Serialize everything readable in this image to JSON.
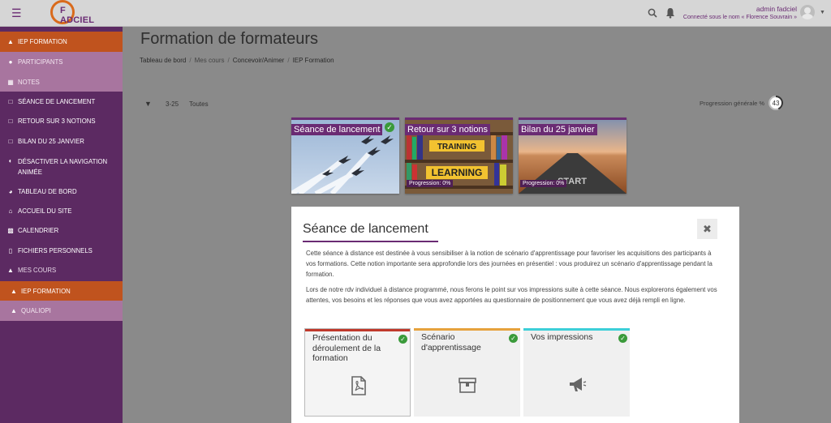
{
  "topbar": {
    "menu_icon": "hamburger-icon",
    "logo_text": "F ADCIEL",
    "user_name": "admin fadciel",
    "user_role": "Connecté sous le nom « Florence Souvrain »",
    "search_icon": "search-icon",
    "bell_icon": "bell-icon"
  },
  "sidebar": {
    "items": [
      {
        "label": "IEP FORMATION",
        "icon": "graduation-cap-icon",
        "state": "active"
      },
      {
        "label": "PARTICIPANTS",
        "icon": "users-icon",
        "state": "sub"
      },
      {
        "label": "NOTES",
        "icon": "table-icon",
        "state": "sub"
      },
      {
        "label": "SÉANCE DE LANCEMENT",
        "icon": "folder-icon",
        "state": "normal"
      },
      {
        "label": "RETOUR SUR 3 NOTIONS",
        "icon": "folder-icon",
        "state": "normal"
      },
      {
        "label": "BILAN DU 25 JANVIER",
        "icon": "folder-icon",
        "state": "normal"
      },
      {
        "label": "DÉSACTIVER LA NAVIGATION ANIMÉE",
        "icon": "toggle-icon",
        "state": "normal"
      },
      {
        "label": "TABLEAU DE BORD",
        "icon": "dashboard-icon",
        "state": "normal"
      },
      {
        "label": "ACCUEIL DU SITE",
        "icon": "home-icon",
        "state": "normal"
      },
      {
        "label": "CALENDRIER",
        "icon": "calendar-icon",
        "state": "normal"
      },
      {
        "label": "FICHIERS PERSONNELS",
        "icon": "file-icon",
        "state": "normal"
      },
      {
        "label": "MES COURS",
        "icon": "graduation-cap-icon",
        "state": "normal"
      },
      {
        "label": "IEP FORMATION",
        "icon": "graduation-cap-icon",
        "state": "active-sub"
      },
      {
        "label": "QUALIOPI",
        "icon": "graduation-cap-icon",
        "state": "sub2"
      }
    ]
  },
  "main": {
    "title": "Formation de formateurs",
    "breadcrumb": [
      "Tableau de bord",
      "Mes cours",
      "Concevoir/Animer",
      "IEP Formation"
    ],
    "filter": {
      "range": "3-25",
      "all": "Toutes"
    },
    "progress": {
      "label": "Progression générale %",
      "value": 43
    }
  },
  "cards": [
    {
      "title": "Séance de lancement",
      "completed": true,
      "progress": ""
    },
    {
      "title": "Retour sur 3 notions",
      "completed": false,
      "progress": "Progression: 0%"
    },
    {
      "title": "Bilan du 25 janvier",
      "completed": false,
      "progress": "Progression: 0%"
    }
  ],
  "modal": {
    "title": "Séance de lancement",
    "close_icon": "close-icon",
    "paragraph1": "Cette séance à distance est destinée à vous sensibiliser à la notion de scénario d'apprentissage pour favoriser les acquisitions des participants à vos formations. Cette notion importante sera approfondie lors des journées en présentiel : vous produirez un scénario d'apprentissage pendant la formation.",
    "paragraph2": "Lors de notre rdv individuel à distance programmé, nous ferons le point sur vos impressions suite à cette séance. Nous explorerons également vos attentes, vos besoins et les réponses que vous avez apportées au questionnaire de positionnement que vous avez déjà rempli en ligne.",
    "tiles": [
      {
        "title": "Présentation du déroulement de la formation",
        "icon": "pdf-file-icon",
        "bar_color": "#c0392b",
        "completed": true
      },
      {
        "title": "Scénario d'apprentissage",
        "icon": "archive-box-icon",
        "bar_color": "#e6a23c",
        "completed": true
      },
      {
        "title": "Vos impressions",
        "icon": "megaphone-icon",
        "bar_color": "#3ccfd8",
        "completed": true
      }
    ]
  },
  "colors": {
    "brand_purple": "#6a2b73",
    "brand_orange": "#c0531e",
    "sidebar_bg": "#5c2a62",
    "check_green": "#3a9a3a"
  }
}
